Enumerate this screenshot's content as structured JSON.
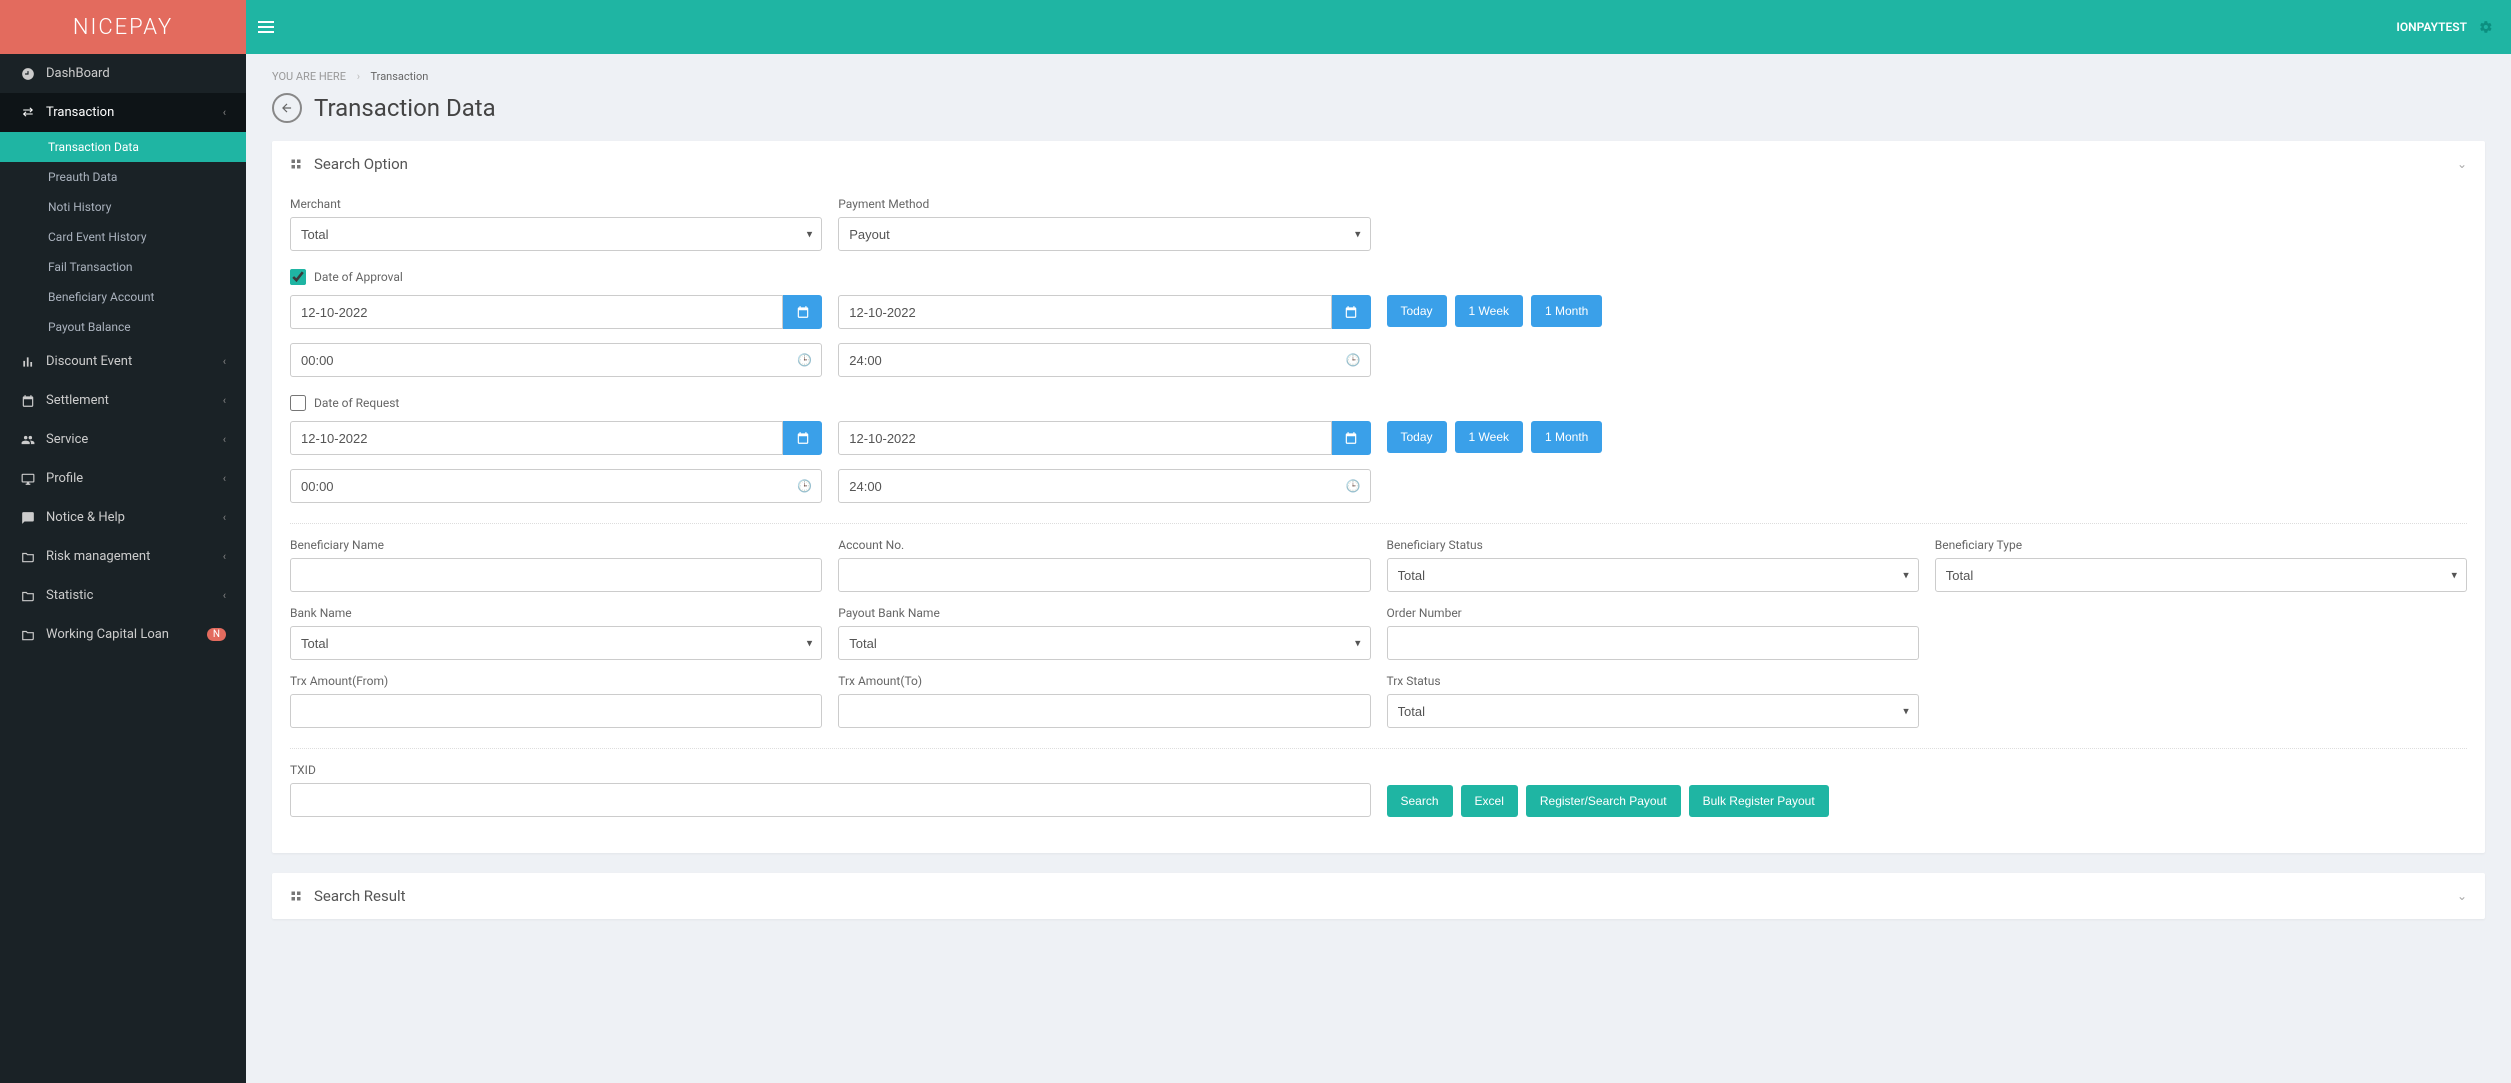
{
  "brand": "NICEPAY",
  "user": "IONPAYTEST",
  "breadcrumb": {
    "label": "YOU ARE HERE",
    "current": "Transaction"
  },
  "page_title": "Transaction Data",
  "sidebar": {
    "items": [
      {
        "label": "DashBoard"
      },
      {
        "label": "Transaction"
      },
      {
        "label": "Discount Event"
      },
      {
        "label": "Settlement"
      },
      {
        "label": "Service"
      },
      {
        "label": "Profile"
      },
      {
        "label": "Notice & Help"
      },
      {
        "label": "Risk management"
      },
      {
        "label": "Statistic"
      },
      {
        "label": "Working Capital Loan"
      }
    ],
    "transaction_sub": [
      {
        "label": "Transaction Data"
      },
      {
        "label": "Preauth Data"
      },
      {
        "label": "Noti History"
      },
      {
        "label": "Card Event History"
      },
      {
        "label": "Fail Transaction"
      },
      {
        "label": "Beneficiary Account"
      },
      {
        "label": "Payout Balance"
      }
    ],
    "badge_n": "N"
  },
  "search_option": {
    "title": "Search Option",
    "merchant_label": "Merchant",
    "merchant_value": "Total",
    "payment_method_label": "Payment Method",
    "payment_method_value": "Payout",
    "date_approval_label": "Date of Approval",
    "date_request_label": "Date of Request",
    "date1_from": "12-10-2022",
    "date1_to": "12-10-2022",
    "time1_from": "00:00",
    "time1_to": "24:00",
    "date2_from": "12-10-2022",
    "date2_to": "12-10-2022",
    "time2_from": "00:00",
    "time2_to": "24:00",
    "quick": {
      "today": "Today",
      "week": "1 Week",
      "month": "1 Month"
    },
    "beneficiary_name_label": "Beneficiary Name",
    "account_no_label": "Account No.",
    "beneficiary_status_label": "Beneficiary Status",
    "beneficiary_status_value": "Total",
    "beneficiary_type_label": "Beneficiary Type",
    "beneficiary_type_value": "Total",
    "bank_name_label": "Bank Name",
    "bank_name_value": "Total",
    "payout_bank_label": "Payout Bank Name",
    "payout_bank_value": "Total",
    "order_number_label": "Order Number",
    "trx_amount_from_label": "Trx Amount(From)",
    "trx_amount_to_label": "Trx Amount(To)",
    "trx_status_label": "Trx Status",
    "trx_status_value": "Total",
    "txid_label": "TXID",
    "buttons": {
      "search": "Search",
      "excel": "Excel",
      "register_search": "Register/Search Payout",
      "bulk_register": "Bulk Register Payout"
    }
  },
  "search_result": {
    "title": "Search Result"
  }
}
